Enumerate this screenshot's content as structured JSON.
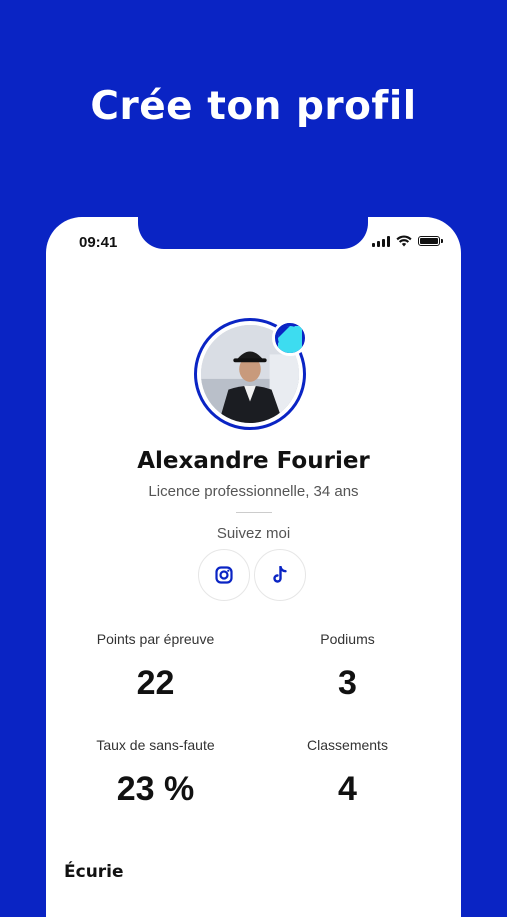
{
  "headline": "Crée ton profil",
  "status": {
    "time": "09:41"
  },
  "profile": {
    "name": "Alexandre Fourier",
    "subtitle": "Licence professionnelle, 34 ans",
    "follow_label": "Suivez moi",
    "socials": [
      "instagram-icon",
      "tiktok-icon"
    ]
  },
  "stats": [
    {
      "label": "Points par épreuve",
      "value": "22"
    },
    {
      "label": "Podiums",
      "value": "3"
    },
    {
      "label": "Taux de sans-faute",
      "value": "23 %"
    },
    {
      "label": "Classements",
      "value": "4"
    }
  ],
  "section": {
    "title": "Écurie"
  },
  "colors": {
    "brand": "#0a24c4",
    "accent": "#3ddcf0"
  }
}
